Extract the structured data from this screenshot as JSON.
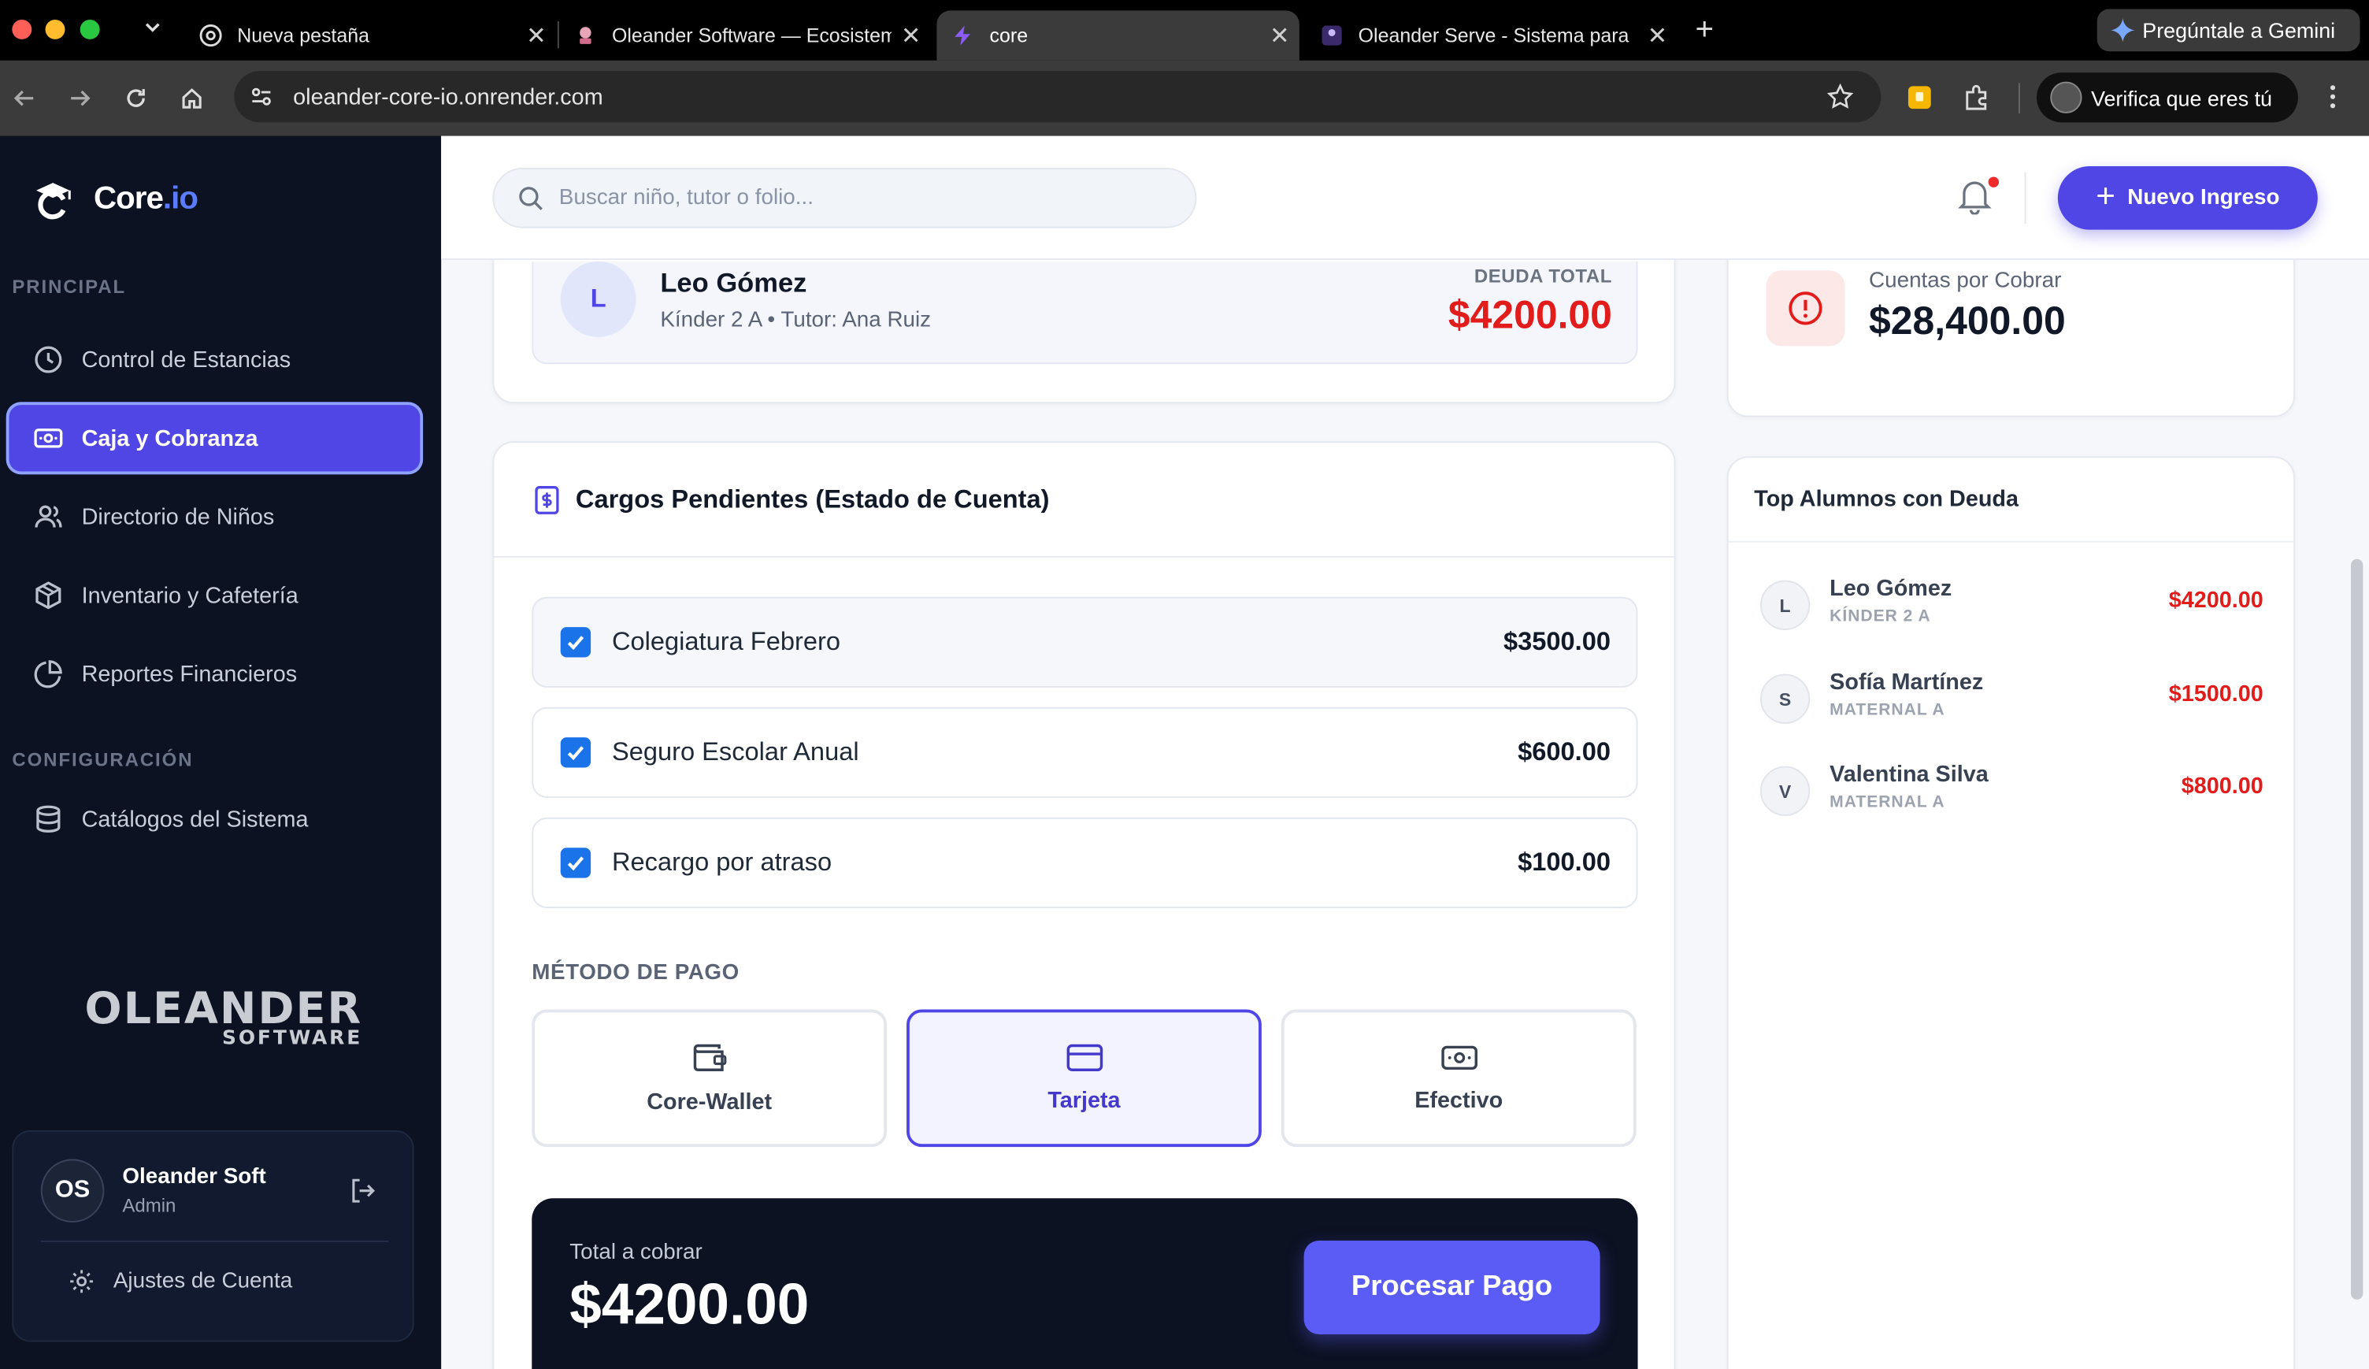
{
  "browser": {
    "tabs": [
      {
        "title": "Nueva pestaña"
      },
      {
        "title": "Oleander Software — Ecosistema"
      },
      {
        "title": "core"
      },
      {
        "title": "Oleander Serve - Sistema para"
      }
    ],
    "url": "oleander-core-io.onrender.com",
    "gemini_label": "Pregúntale a Gemini",
    "profile_label": "Verifica que eres tú"
  },
  "sidebar": {
    "brand_main": "Core",
    "brand_suffix": ".io",
    "section_principal": "PRINCIPAL",
    "section_config": "CONFIGURACIÓN",
    "items": [
      {
        "label": "Control de Estancias",
        "icon": "clock-icon"
      },
      {
        "label": "Caja y Cobranza",
        "icon": "cash-icon"
      },
      {
        "label": "Directorio de Niños",
        "icon": "users-icon"
      },
      {
        "label": "Inventario y Cafetería",
        "icon": "box-icon"
      },
      {
        "label": "Reportes Financieros",
        "icon": "pie-chart-icon"
      }
    ],
    "config_items": [
      {
        "label": "Catálogos del Sistema",
        "icon": "database-icon"
      }
    ],
    "logo_line1": "OLEANDER",
    "logo_line2": "SOFTWARE",
    "user": {
      "initials": "OS",
      "name": "Oleander Soft",
      "role": "Admin"
    },
    "settings_label": "Ajustes de Cuenta"
  },
  "topbar": {
    "search_placeholder": "Buscar niño, tutor o folio...",
    "new_button": "Nuevo Ingreso"
  },
  "student": {
    "initial": "L",
    "name": "Leo Gómez",
    "subtitle": "Kínder 2 A • Tutor: Ana Ruiz",
    "debt_label": "DEUDA TOTAL",
    "debt_amount": "$4200.00"
  },
  "charges": {
    "title": "Cargos Pendientes (Estado de Cuenta)",
    "items": [
      {
        "label": "Colegiatura Febrero",
        "amount": "$3500.00",
        "checked": true
      },
      {
        "label": "Seguro Escolar Anual",
        "amount": "$600.00",
        "checked": true
      },
      {
        "label": "Recargo por atraso",
        "amount": "$100.00",
        "checked": true
      }
    ],
    "method_label": "MÉTODO DE PAGO",
    "methods": [
      {
        "label": "Core-Wallet",
        "icon": "wallet-icon"
      },
      {
        "label": "Tarjeta",
        "icon": "credit-card-icon",
        "selected": true
      },
      {
        "label": "Efectivo",
        "icon": "cash-icon"
      }
    ],
    "total_label": "Total a cobrar",
    "total_amount": "$4200.00",
    "pay_button": "Procesar Pago"
  },
  "receivables": {
    "label": "Cuentas por Cobrar",
    "value": "$28,400.00"
  },
  "top_debtors": {
    "title": "Top Alumnos con Deuda",
    "items": [
      {
        "initial": "L",
        "name": "Leo Gómez",
        "group": "KÍNDER 2 A",
        "amount": "$4200.00"
      },
      {
        "initial": "S",
        "name": "Sofía Martínez",
        "group": "MATERNAL A",
        "amount": "$1500.00"
      },
      {
        "initial": "V",
        "name": "Valentina Silva",
        "group": "MATERNAL A",
        "amount": "$800.00"
      }
    ]
  },
  "colors": {
    "accent": "#4f46e5",
    "danger": "#e21b1b",
    "sidebar": "#0c1222"
  }
}
